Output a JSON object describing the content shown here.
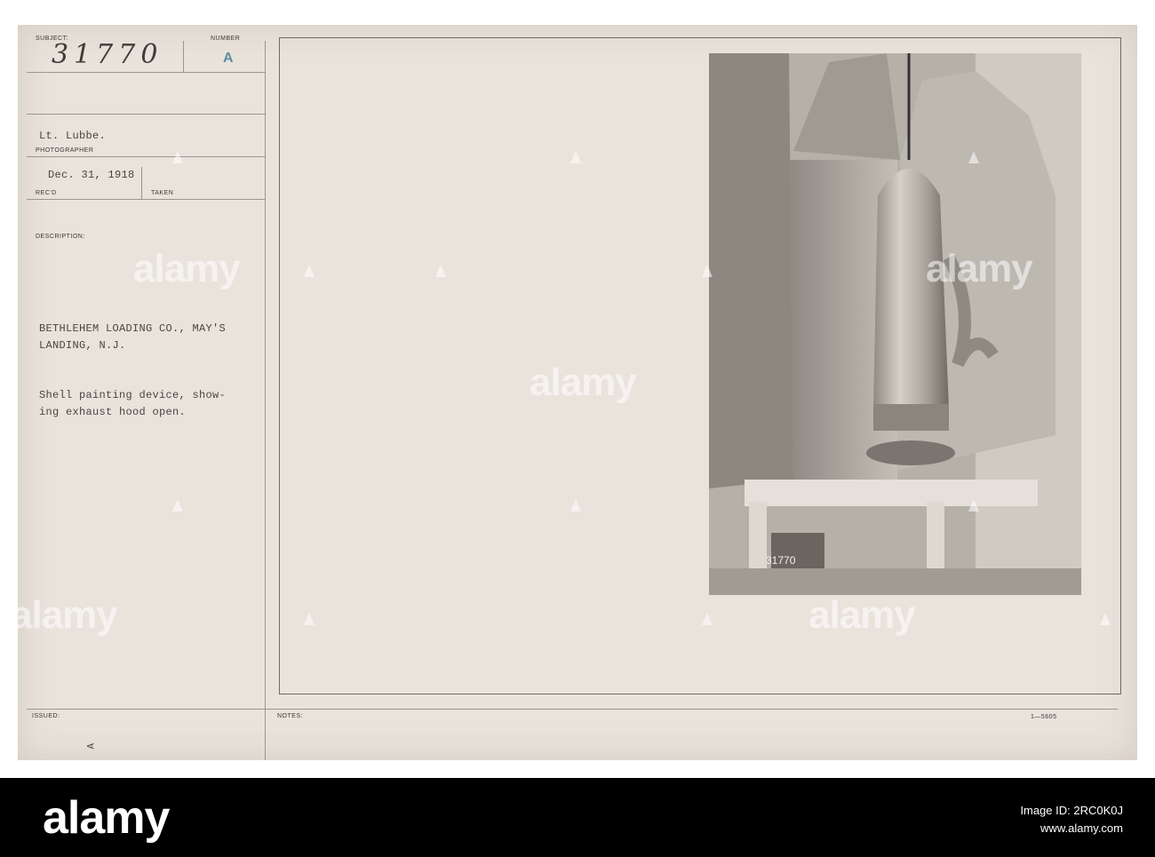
{
  "card": {
    "labels": {
      "subject": "SUBJECT:",
      "number": "NUMBER",
      "photographer": "PHOTOGRAPHER",
      "recd": "REC'D",
      "taken": "TAKEN",
      "description": "DESCRIPTION:",
      "issued": "ISSUED:",
      "notes": "NOTES:"
    },
    "subject_number": "31770",
    "number_value": "A",
    "photographer_name": "Lt. Lubbe.",
    "received_date": "Dec. 31, 1918",
    "description_lines": [
      "BETHLEHEM LOADING CO., MAY'S",
      "LANDING, N.J.",
      "Shell painting device, show-",
      "ing exhaust hood open."
    ],
    "photo_inscription": "31770",
    "issued_mark": "A",
    "form_code": "1—5605"
  },
  "watermark": {
    "text": "alamy"
  },
  "footer": {
    "logo": "alamy",
    "image_id_label": "Image ID: 2RC0K0J",
    "site": "www.alamy.com"
  },
  "colors": {
    "card": "#e9e3dc",
    "stamp": "#5f8fa4",
    "footer": "#000000"
  }
}
